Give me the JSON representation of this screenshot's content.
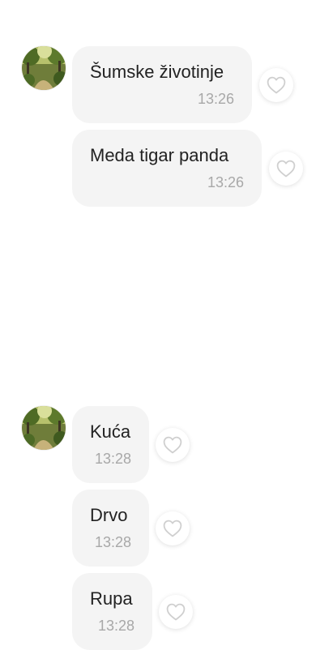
{
  "groups": [
    {
      "messages": [
        {
          "text": "Šumske životinje",
          "time": "13:26"
        },
        {
          "text": "Meda tigar panda",
          "time": "13:26"
        }
      ]
    },
    {
      "messages": [
        {
          "text": "Kuća",
          "time": "13:28"
        },
        {
          "text": "Drvo",
          "time": "13:28"
        },
        {
          "text": "Rupa",
          "time": "13:28"
        }
      ]
    }
  ],
  "icons": {
    "like": "heart-outline-icon",
    "avatar": "forest-photo-avatar"
  },
  "colors": {
    "bubble": "#f4f4f4",
    "text": "#222222",
    "time": "#a8a8a8",
    "heart_stroke": "#cfcfcf"
  }
}
